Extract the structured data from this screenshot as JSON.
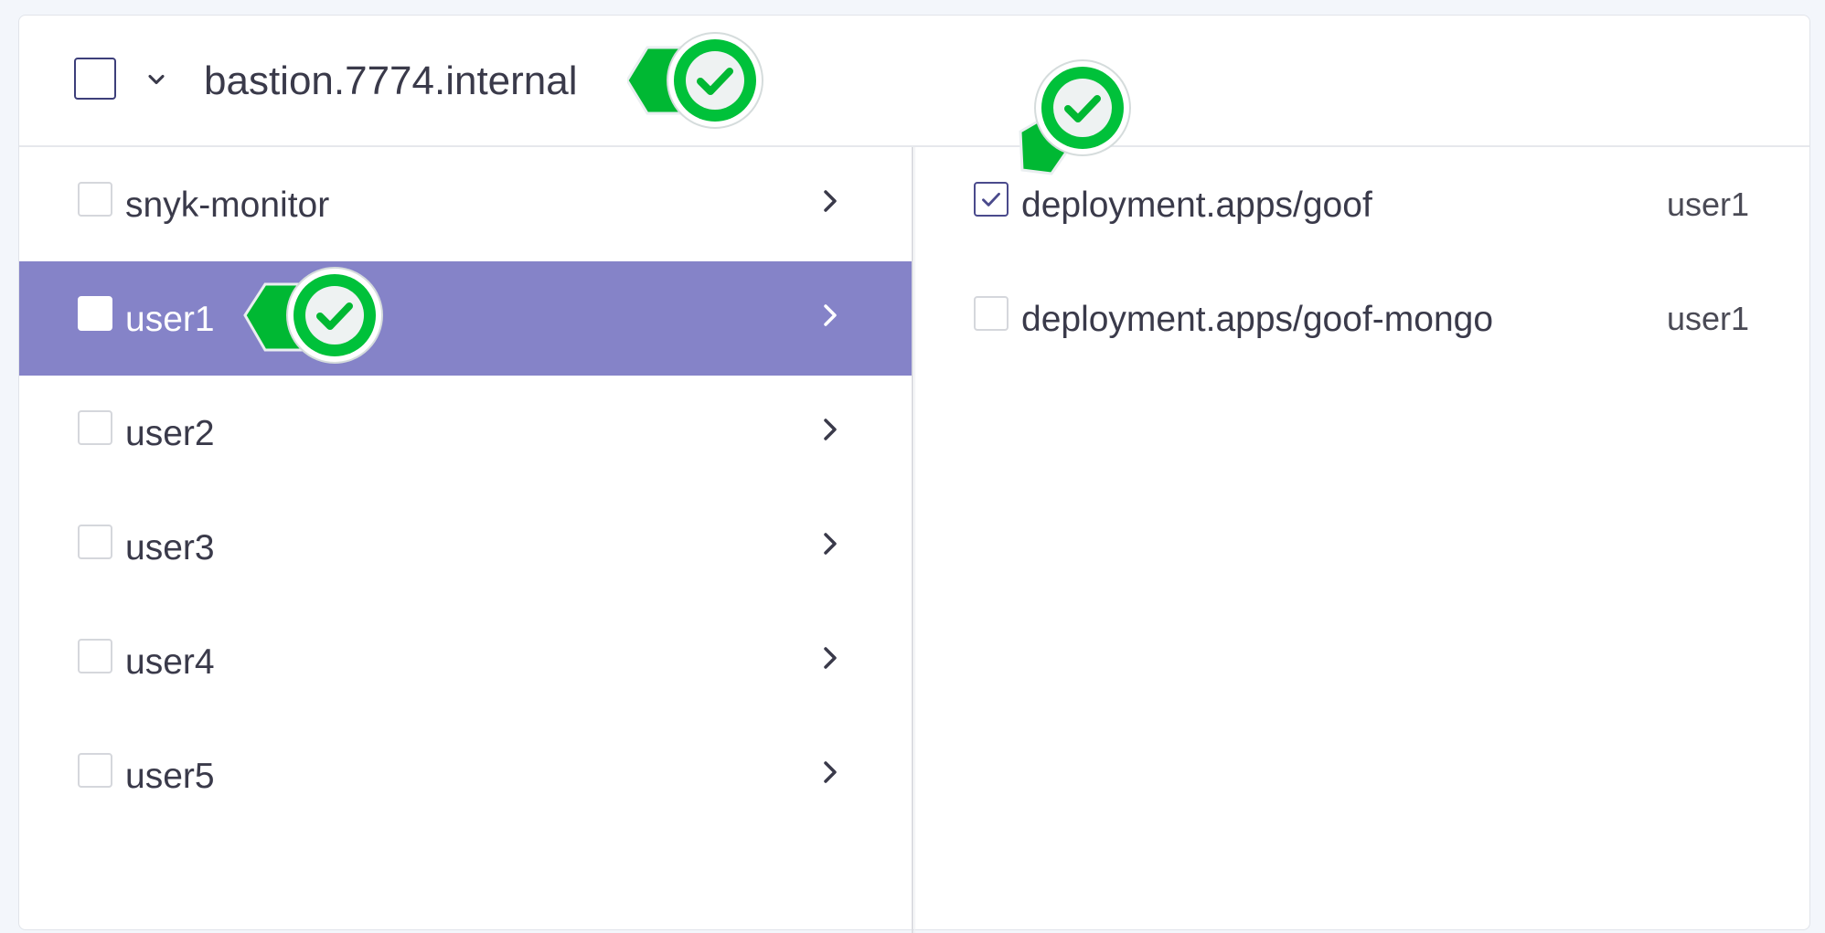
{
  "header": {
    "title": "bastion.7774.internal"
  },
  "namespaces": [
    {
      "label": "snyk-monitor",
      "selected": false
    },
    {
      "label": "user1",
      "selected": true
    },
    {
      "label": "user2",
      "selected": false
    },
    {
      "label": "user3",
      "selected": false
    },
    {
      "label": "user4",
      "selected": false
    },
    {
      "label": "user5",
      "selected": false
    }
  ],
  "workloads": [
    {
      "label": "deployment.apps/goof",
      "owner": "user1",
      "checked": true
    },
    {
      "label": "deployment.apps/goof-mongo",
      "owner": "user1",
      "checked": false
    }
  ],
  "colors": {
    "selected_row": "#8583c8",
    "badge_green": "#00c13a",
    "checkbox_border_active": "#3d3f7a"
  },
  "icons": [
    "chevron-down-icon",
    "chevron-right-icon",
    "checkmark-icon",
    "monitored-badge-icon"
  ]
}
